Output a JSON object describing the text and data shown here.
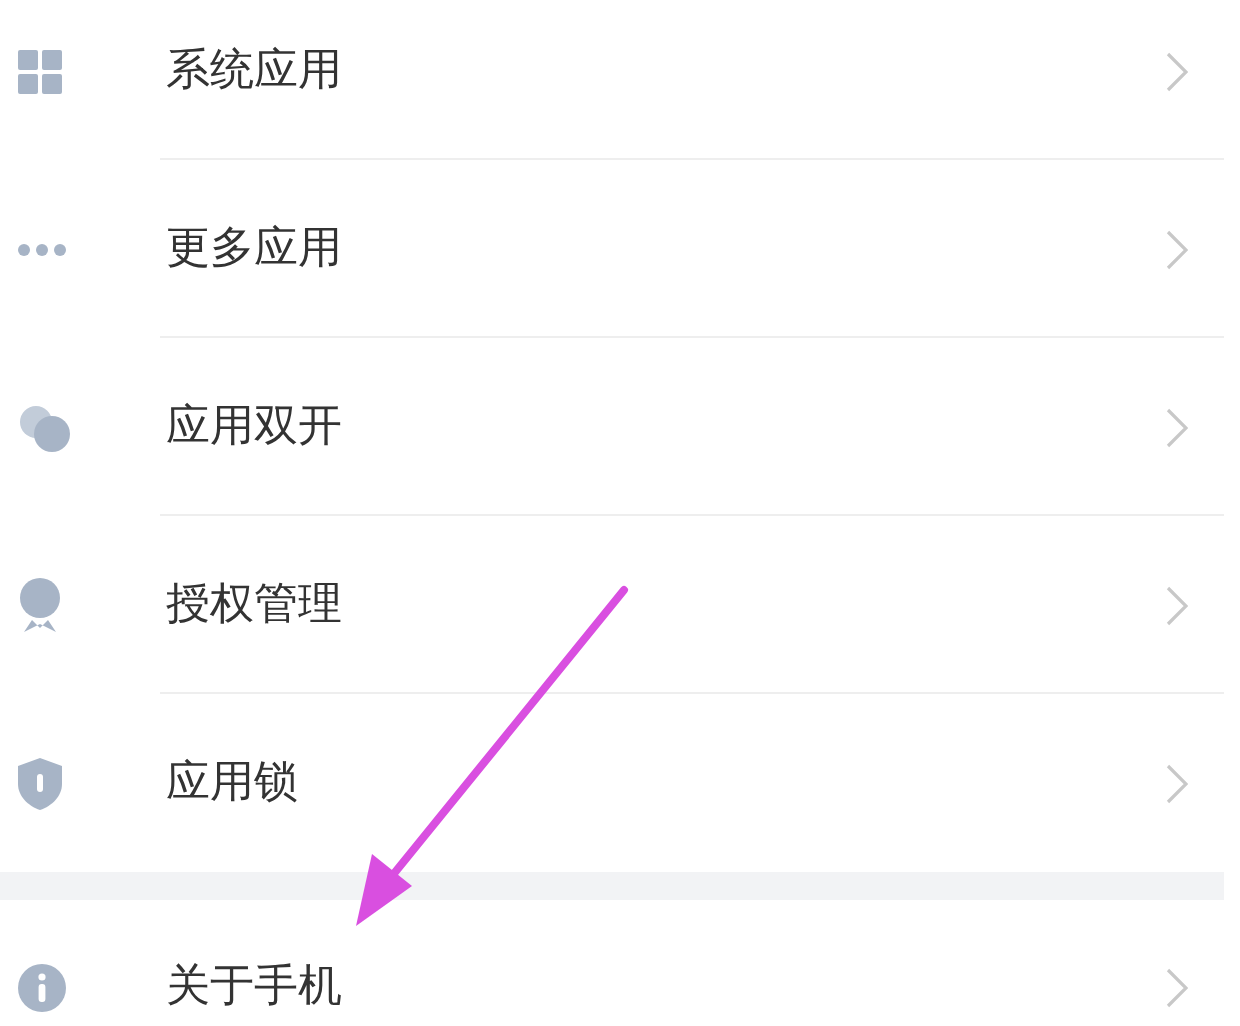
{
  "sections": [
    {
      "items": [
        {
          "label": "系统应用",
          "kind": "grid"
        },
        {
          "label": "更多应用",
          "kind": "dots"
        },
        {
          "label": "应用双开",
          "kind": "bubbles"
        },
        {
          "label": "授权管理",
          "kind": "medal"
        },
        {
          "label": "应用锁",
          "kind": "shield"
        }
      ]
    },
    {
      "items": [
        {
          "label": "关于手机",
          "kind": "info"
        }
      ]
    }
  ]
}
